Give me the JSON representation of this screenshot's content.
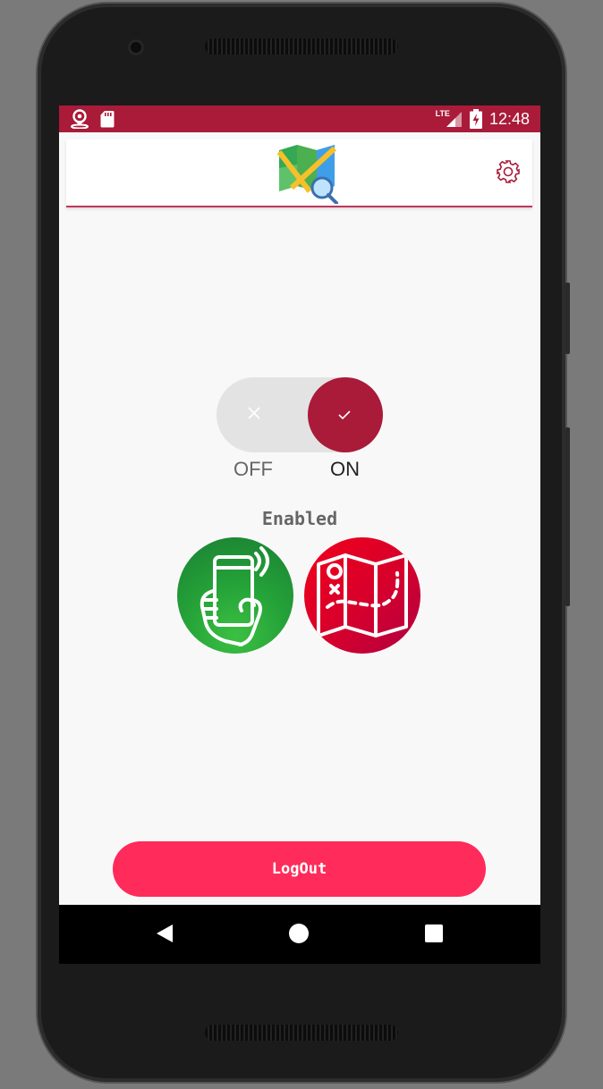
{
  "status_bar": {
    "time": "12:48",
    "network": "LTE",
    "icons": [
      "location-person-icon",
      "sd-card-icon",
      "signal-icon",
      "battery-charging-icon"
    ]
  },
  "app_bar": {
    "logo": "map-search-logo",
    "settings_icon": "gear-icon"
  },
  "toggle": {
    "state": "on",
    "off_label": "OFF",
    "on_label": "ON"
  },
  "status": {
    "text": "Enabled"
  },
  "feature_icons": [
    {
      "icon": "phone-vibrate-hand-icon",
      "color": "#1f9a36"
    },
    {
      "icon": "treasure-map-icon",
      "color": "#e1001f"
    }
  ],
  "actions": {
    "logout_label": "LogOut"
  },
  "colors": {
    "primary": "#a91b39",
    "accent": "#ff2b5a"
  },
  "nav_bar": {
    "buttons": [
      "back-icon",
      "home-icon",
      "recents-icon"
    ]
  }
}
